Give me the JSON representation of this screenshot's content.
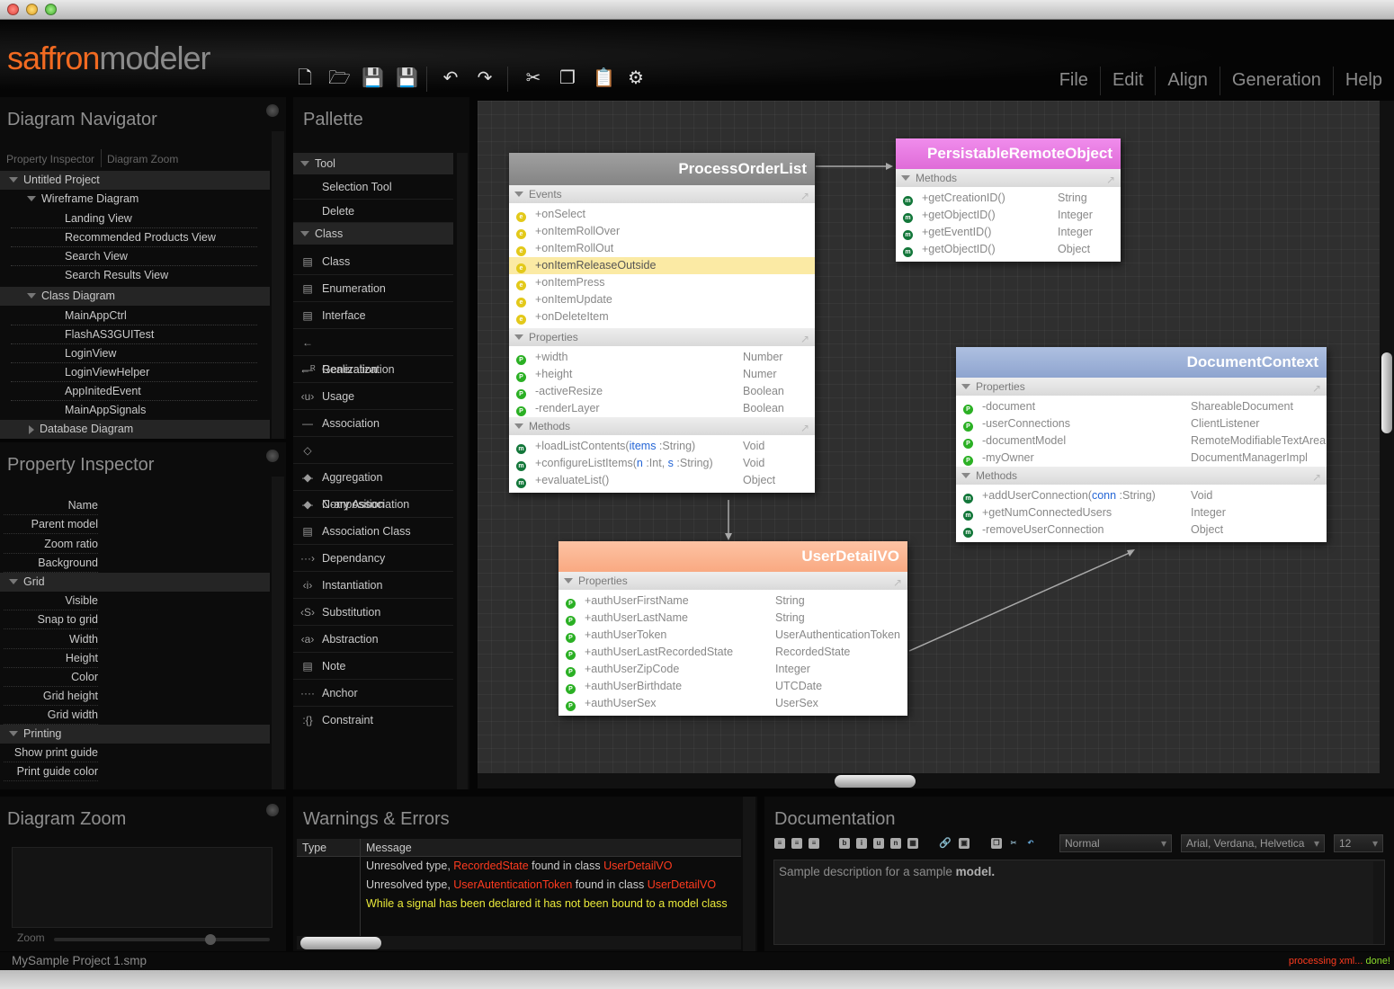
{
  "logo": {
    "part1": "saffron",
    "part2": "modeler"
  },
  "menu": [
    "File",
    "Edit",
    "Align",
    "Generation",
    "Help"
  ],
  "navigator": {
    "title": "Diagram Navigator",
    "tabs": [
      "Property Inspector",
      "Diagram Zoom"
    ],
    "project": "Untitled Project",
    "wireframe": {
      "label": "Wireframe Diagram",
      "items": [
        "Landing View",
        "Recommended Products View",
        "Search View",
        "Search Results View"
      ]
    },
    "classdiagram": {
      "label": "Class Diagram",
      "items": [
        "MainAppCtrl",
        "FlashAS3GUITest",
        "LoginView",
        "LoginViewHelper",
        "AppInitedEvent",
        "MainAppSignals"
      ]
    },
    "database": "Database Diagram"
  },
  "inspector": {
    "title": "Property Inspector",
    "props": [
      "Name",
      "Parent model",
      "Zoom ratio",
      "Background"
    ],
    "grid": {
      "label": "Grid",
      "props": [
        "Visible",
        "Snap to grid",
        "Width",
        "Height",
        "Color",
        "Grid height",
        "Grid width"
      ]
    },
    "printing": {
      "label": "Printing",
      "props": [
        "Show print guide",
        "Print guide color"
      ]
    }
  },
  "palette": {
    "title": "Pallette",
    "tool": {
      "label": "Tool",
      "items": [
        "Selection Tool",
        "Delete"
      ]
    },
    "class": {
      "label": "Class",
      "items": [
        "Class",
        "Enumeration",
        "Interface",
        "Generalization",
        "Realization",
        "Usage",
        "Association",
        "Aggregation",
        "Composition",
        "N-ary Association",
        "Association Class",
        "Dependancy",
        "Instantiation",
        "Substitution",
        "Abstraction",
        "Note",
        "Anchor",
        "Constraint"
      ]
    }
  },
  "classes": {
    "processorder": {
      "name": "ProcessOrderList",
      "color": "#8c8c8c",
      "sec_events": "Events",
      "events": [
        "+onSelect",
        "+onItemRollOver",
        "+onItemRollOut",
        "+onItemReleaseOutside",
        "+onItemPress",
        "+onItemUpdate",
        "+onDeleteItem"
      ],
      "sec_props": "Properties",
      "props": [
        {
          "n": "+width",
          "t": "Number"
        },
        {
          "n": "+height",
          "t": "Numer"
        },
        {
          "n": "-activeResize",
          "t": "Boolean"
        },
        {
          "n": "-renderLayer",
          "t": "Boolean"
        }
      ],
      "sec_methods": "Methods",
      "methods": [
        {
          "pre": "+loadListContents(",
          "p1": "items",
          "mid": " :String)",
          "p2": "",
          "post": "",
          "t": "Void"
        },
        {
          "pre": "+configureListItems(",
          "p1": "n",
          "mid": " :Int, ",
          "p2": "s",
          "post": " :String)",
          "t": "Void"
        },
        {
          "pre": "+evaluateList()",
          "p1": "",
          "mid": "",
          "p2": "",
          "post": "",
          "t": "Object"
        }
      ]
    },
    "persistable": {
      "name": "PersistableRemoteObject",
      "color": "#e67be0",
      "sec_methods": "Methods",
      "methods": [
        {
          "n": "+getCreationID()",
          "t": "String"
        },
        {
          "n": "+getObjectID()",
          "t": "Integer"
        },
        {
          "n": "+getEventID()",
          "t": "Integer"
        },
        {
          "n": "+getObjectID()",
          "t": "Object"
        }
      ]
    },
    "documentcontext": {
      "name": "DocumentContext",
      "color": "#9db1d6",
      "sec_props": "Properties",
      "props": [
        {
          "n": "-document",
          "t": "ShareableDocument"
        },
        {
          "n": "-userConnections",
          "t": "ClientListener"
        },
        {
          "n": "-documentModel",
          "t": "RemoteModifiableTextArea"
        },
        {
          "n": "-myOwner",
          "t": "DocumentManagerImpl"
        }
      ],
      "sec_methods": "Methods",
      "methods": [
        {
          "pre": "+addUserConnection(",
          "p1": "conn",
          "mid": " :String)",
          "t": "Void"
        },
        {
          "pre": "+getNumConnectedUsers",
          "p1": "",
          "mid": "",
          "t": "Integer"
        },
        {
          "pre": "-removeUserConnection",
          "p1": "",
          "mid": "",
          "t": "Object"
        }
      ]
    },
    "userdetail": {
      "name": "UserDetailVO",
      "color": "#fbb693",
      "sec_props": "Properties",
      "props": [
        {
          "n": "+authUserFirstName",
          "t": "String"
        },
        {
          "n": "+authUserLastName",
          "t": "String"
        },
        {
          "n": "+authUserToken",
          "t": "UserAuthenticationToken"
        },
        {
          "n": "+authUserLastRecordedState",
          "t": "RecordedState"
        },
        {
          "n": "+authUserZipCode",
          "t": "Integer"
        },
        {
          "n": "+authUserBirthdate",
          "t": "UTCDate"
        },
        {
          "n": "+authUserSex",
          "t": "UserSex"
        }
      ]
    }
  },
  "zoom": {
    "title": "Diagram Zoom",
    "label": "Zoom"
  },
  "warnings": {
    "title": "Warnings & Errors",
    "col_type": "Type",
    "col_message": "Message",
    "rows": [
      {
        "a": "Unresolved type, ",
        "b": "RecordedState",
        "c": " found in class ",
        "d": "UserDetailVO"
      },
      {
        "a": "Unresolved type, ",
        "b": "UserAutenticationToken",
        "c": " found in class ",
        "d": "UserDetailVO"
      }
    ],
    "row3": "While a signal has been declared it has not been bound to a model class"
  },
  "documentation": {
    "title": "Documentation",
    "style": "Normal",
    "font": "Arial, Verdana, Helvetica",
    "size": "12",
    "text_pre": "Sample description for a sample ",
    "text_bold": "model."
  },
  "status": {
    "file": "MySample Project 1.smp",
    "msg1": "processing xml...",
    "msg2": " done!"
  }
}
